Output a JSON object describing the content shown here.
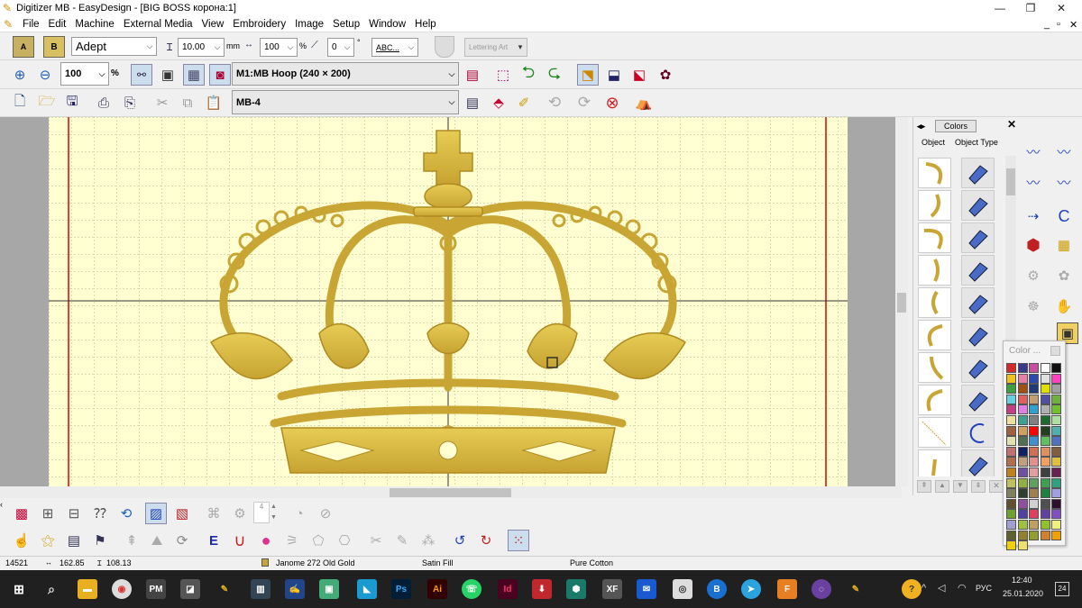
{
  "window": {
    "title": "Digitizer MB - EasyDesign - [BIG BOSS корона:1]",
    "btn_min": "—",
    "btn_max": "❐",
    "btn_close": "✕",
    "mdi_min": "_",
    "mdi_restore": "▫",
    "mdi_close": "✕"
  },
  "menu": [
    "File",
    "Edit",
    "Machine",
    "External Media",
    "View",
    "Embroidery",
    "Image",
    "Setup",
    "Window",
    "Help"
  ],
  "toolbar1": {
    "font": "Adept",
    "height": "10.00",
    "height_unit": "mm",
    "width": "100",
    "width_unit": "%",
    "angle": "0",
    "angle_unit": "°",
    "style": "ABC...",
    "lettering_art": "Lettering Art"
  },
  "toolbar2": {
    "zoom": "100",
    "zoom_unit": "%",
    "hoop": "M1:MB Hoop (240 × 200)"
  },
  "toolbar3": {
    "machine": "MB-4"
  },
  "rpanel": {
    "colors_tab": "Colors",
    "col_object": "Object",
    "col_object_type": "Object Type",
    "close": "✕",
    "nav": "◂▸"
  },
  "bottom": {
    "stepper_value": "4"
  },
  "colorpop": {
    "title": "Color ...",
    "colors": [
      "#d42a2a",
      "#3a3a8c",
      "#c84fa0",
      "#ffffff",
      "#101010",
      "#f0c020",
      "#e87fa6",
      "#2a4ab0",
      "#e0e0e0",
      "#ff40c0",
      "#40a040",
      "#a05010",
      "#203a78",
      "#e0e000",
      "#a0a0a0",
      "#6ad0e0",
      "#e06060",
      "#c0a070",
      "#5050a0",
      "#70b040",
      "#c04080",
      "#e080e0",
      "#30a0d0",
      "#b0b0b0",
      "#70c030",
      "#f0e0a0",
      "#40a090",
      "#808080",
      "#206a30",
      "#b0e0a0",
      "#a06040",
      "#d0a060",
      "#ff0000",
      "#204020",
      "#50b0b0",
      "#e0e0b0",
      "#507050",
      "#4090d0",
      "#60c060",
      "#5070c0",
      "#c07070",
      "#102060",
      "#d07050",
      "#e09060",
      "#806040",
      "#b07050",
      "#c0a080",
      "#e09090",
      "#f0a060",
      "#e0c040",
      "#c08020",
      "#7050a0",
      "#e0a0a0",
      "#404040",
      "#6a2050",
      "#c0c060",
      "#90b040",
      "#60a060",
      "#40a050",
      "#30a080",
      "#808060",
      "#304030",
      "#a08050",
      "#208040",
      "#a0a0e0",
      "#605030",
      "#9050a0",
      "#d0d0d0",
      "#505050",
      "#301030",
      "#70a030",
      "#5040a0",
      "#e04060",
      "#6040a0",
      "#8050c0",
      "#a0a0d0",
      "#a0c040",
      "#c0a060",
      "#90c030",
      "#f0f080",
      "#606030",
      "#908030",
      "#90a030",
      "#d08030",
      "#f0a000",
      "#f0d000",
      "#f0e070"
    ]
  },
  "status": {
    "stitches": "14521",
    "w": "162.85",
    "h": "108.13",
    "thread": "Janome 272 Old Gold",
    "fill": "Satin Fill",
    "fabric": "Pure Cotton"
  },
  "taskbar": {
    "lang": "РУС",
    "time": "12:40",
    "date": "25.01.2020",
    "notif": "24"
  }
}
